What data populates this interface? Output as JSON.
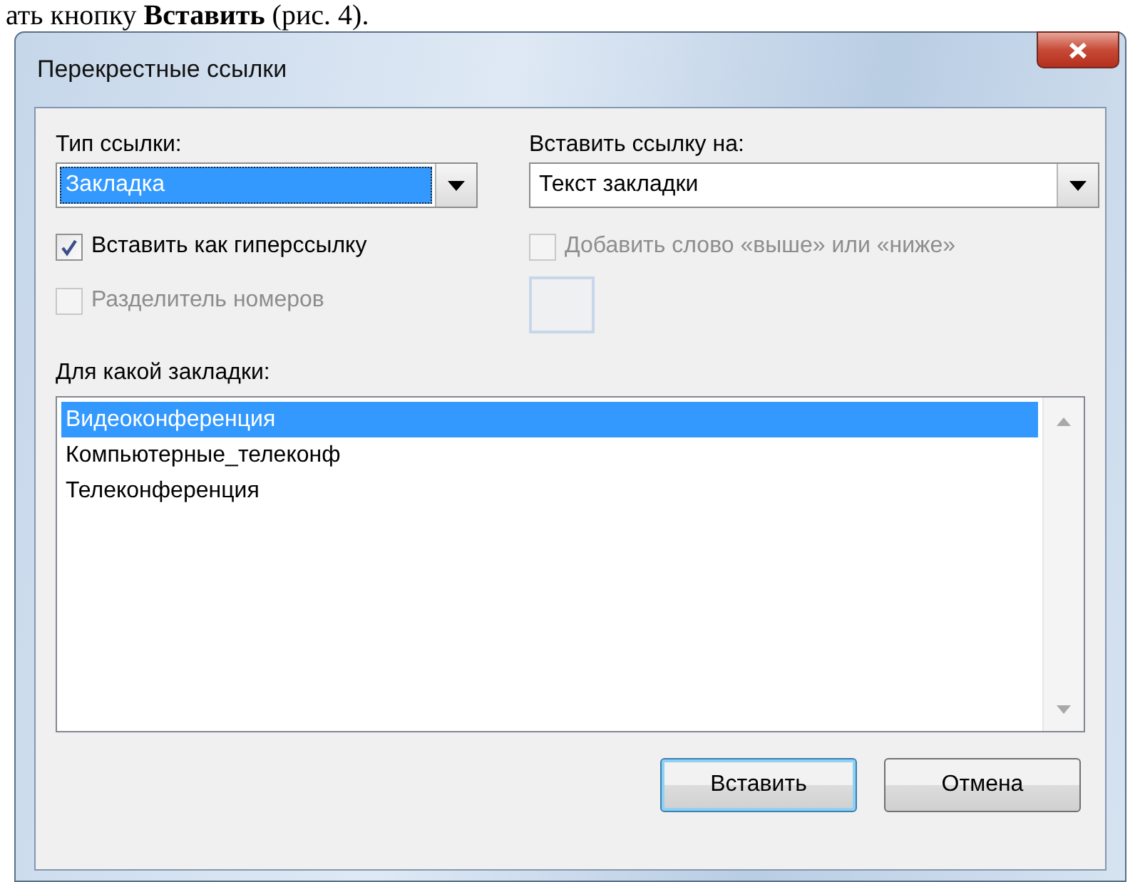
{
  "document_text": "ать кнопку **Вставить** (рис. 4).",
  "window": {
    "title": "Перекрестные ссылки"
  },
  "reference_type": {
    "label": "Тип ссылки:",
    "value": "Закладка",
    "focused": true
  },
  "insert_reference_to": {
    "label": "Вставить ссылку на:",
    "value": "Текст закладки",
    "focused": false
  },
  "checkboxes": [
    {
      "label": "Вставить как гиперссылку",
      "checked": true,
      "disabled": false
    },
    {
      "label": "Добавить слово «выше» или «ниже»",
      "checked": false,
      "disabled": true
    },
    {
      "label": "Разделитель номеров",
      "checked": false,
      "disabled": true
    }
  ],
  "bookmarks": {
    "label": "Для какой закладки:",
    "items": [
      {
        "text": "Видеоконференция",
        "selected": true
      },
      {
        "text": "Компьютерные_телеконф",
        "selected": false
      },
      {
        "text": "Телеконференция",
        "selected": false
      }
    ]
  },
  "buttons": [
    {
      "label": "Вставить",
      "default": true
    },
    {
      "label": "Отмена",
      "default": false
    }
  ]
}
